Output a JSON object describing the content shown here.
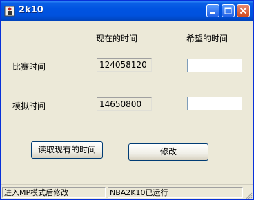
{
  "window": {
    "title": "2k10"
  },
  "columns": {
    "current": "现在的时间",
    "desired": "希望的时间"
  },
  "rows": [
    {
      "label": "比赛时间",
      "current_value": "124058120",
      "desired_value": ""
    },
    {
      "label": "模拟时间",
      "current_value": "14650800",
      "desired_value": ""
    }
  ],
  "buttons": {
    "read": "读取现有的时间",
    "modify": "修改"
  },
  "statusbar": {
    "left": "进入MP模式后修改",
    "right": "NBA2K10已运行"
  },
  "colors": {
    "titlebar": "#0053e1",
    "window_bg": "#ece9d8",
    "close_button": "#d04a1f"
  }
}
